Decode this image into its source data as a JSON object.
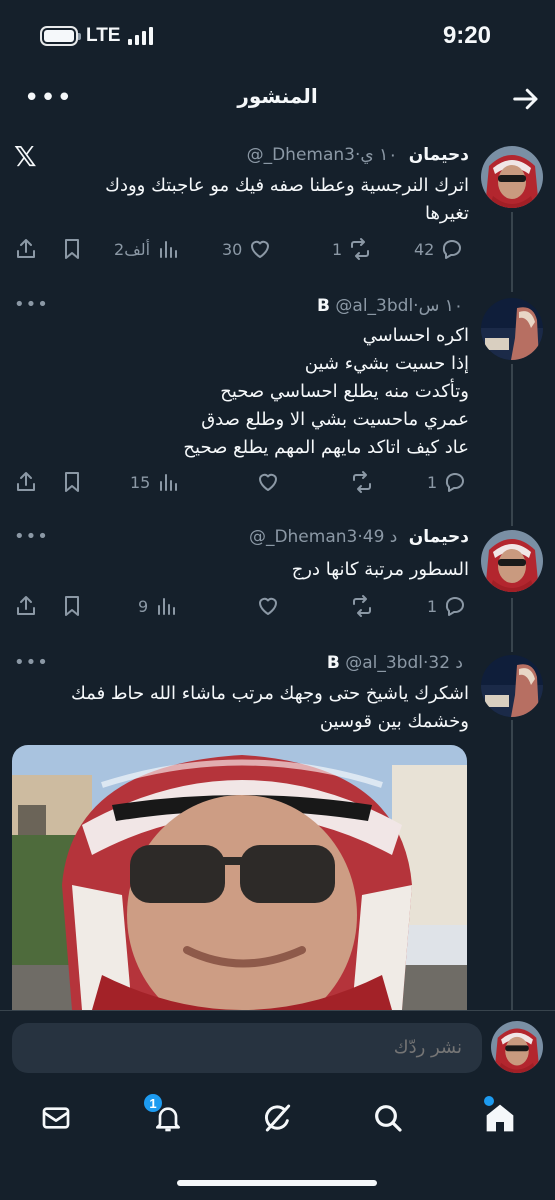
{
  "status_bar": {
    "network": "LTE",
    "time": "9:20"
  },
  "header": {
    "title": "المنشور",
    "more_icon": "more-horizontal-icon",
    "back_icon": "arrow-right-icon"
  },
  "tweets": [
    {
      "name": "دحيمان",
      "handle": "@_Dheman3",
      "time": "١٠ ي",
      "lines": [
        "اترك النرجسية وعطنا صفه فيك مو عاجبتك وودك",
        "تغيرها"
      ],
      "replies": "42",
      "retweets": "1",
      "likes": "30",
      "views": "2ألف"
    },
    {
      "name": "B",
      "handle": "@al_3bdl",
      "time": "١٠ س",
      "lines": [
        "اكره احساسي",
        "إذا حسيت بشيء شين",
        "وتأكدت منه يطلع احساسي صحيح",
        "عمري ماحسيت بشي الا وطلع صدق",
        "عاد كيف اتاكد مايهم المهم يطلع صحيح"
      ],
      "replies": "1",
      "retweets": "",
      "likes": "",
      "views": "15"
    },
    {
      "name": "دحيمان",
      "handle": "@_Dheman3",
      "time": "49 د",
      "lines": [
        "السطور مرتبة كانها درج"
      ],
      "replies": "1",
      "retweets": "",
      "likes": "",
      "views": "9"
    },
    {
      "name": "B",
      "handle": "@al_3bdl",
      "time": "32 د",
      "lines": [
        "اشكرك ياشيخ حتى وجهك مرتب ماشاء الله حاط فمك",
        "وخشمك بين قوسين"
      ]
    }
  ],
  "reply_bar": {
    "placeholder": "نشر ردّك"
  },
  "bottom_nav": {
    "notifications_badge": "1"
  },
  "colors": {
    "background": "#15202b",
    "text": "#f5f8fa",
    "muted": "#8b98a5",
    "accent": "#1d9bf0",
    "divider": "#38444d"
  }
}
